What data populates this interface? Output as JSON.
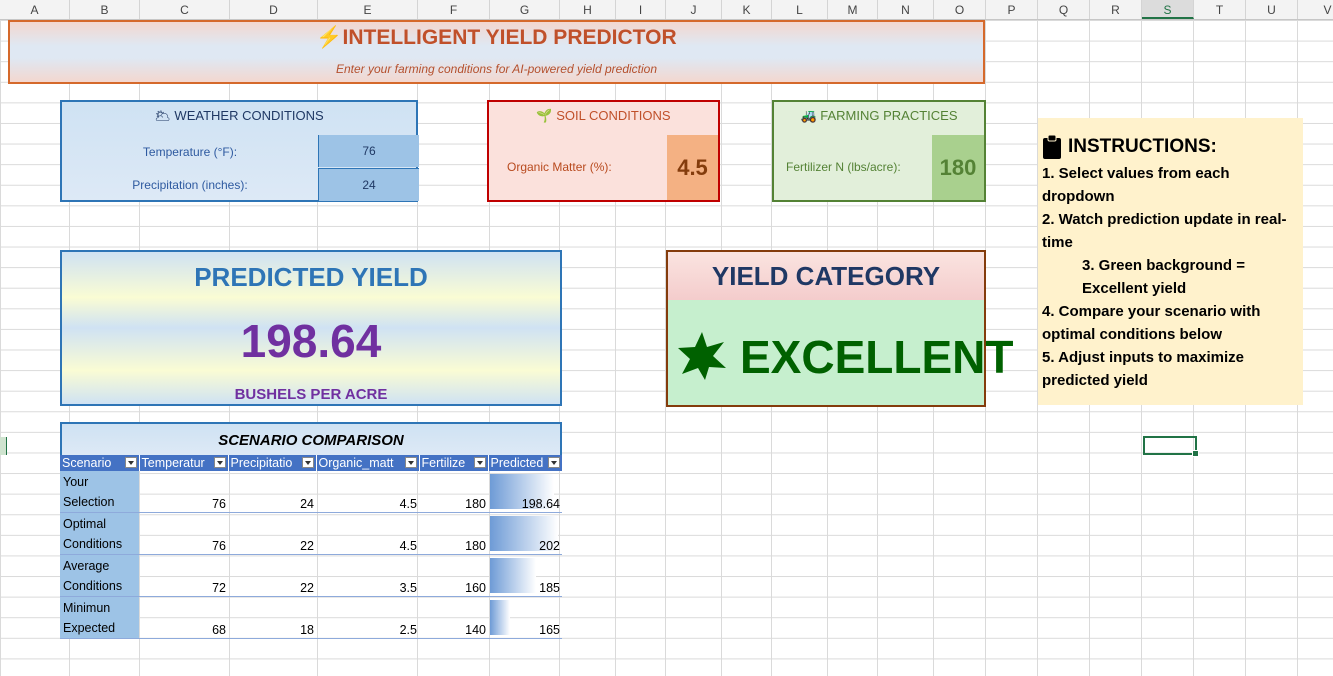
{
  "sheet": {
    "columns": [
      "A",
      "B",
      "C",
      "D",
      "E",
      "F",
      "G",
      "H",
      "I",
      "J",
      "K",
      "L",
      "M",
      "N",
      "O",
      "P",
      "Q",
      "R",
      "S",
      "T",
      "U",
      "V"
    ],
    "selected_column": "S"
  },
  "title": {
    "text": "⚡INTELLIGENT YIELD PREDICTOR",
    "subtitle": "Enter your farming conditions for AI-powered yield prediction"
  },
  "weather": {
    "header": "🌥 WEATHER CONDITIONS",
    "temperature_label": "Temperature (°F):",
    "temperature_value": "76",
    "precip_label": "Precipitation (inches):",
    "precip_value": "24"
  },
  "soil": {
    "header": "🌱 SOIL CONDITIONS",
    "organic_label": "Organic Matter (%):",
    "organic_value": "4.5"
  },
  "farming": {
    "header": "🚜 FARMING PRACTICES",
    "fert_label": "Fertilizer N (lbs/acre):",
    "fert_value": "180"
  },
  "predicted": {
    "header": "PREDICTED YIELD",
    "value": "198.64",
    "unit": "BUSHELS PER ACRE"
  },
  "category": {
    "header": "YIELD CATEGORY",
    "value": "EXCELLENT",
    "icon": "star-icon",
    "color": "#006100"
  },
  "instructions": {
    "header": "INSTRUCTIONS:",
    "icon": "clipboard-icon",
    "lines": [
      "1. Select values from each dropdown",
      "2. Watch prediction update in real-time",
      "3. Green background = Excellent yield",
      "4. Compare your scenario with optimal conditions below",
      "5. Adjust inputs to maximize predicted yield"
    ]
  },
  "scenario": {
    "title": "SCENARIO COMPARISON",
    "columns": [
      "Scenario",
      "Temperatur",
      "Precipitatio",
      "Organic_matt",
      "Fertilize",
      "Predicted"
    ],
    "rows": [
      {
        "name_1": "Your",
        "name_2": "Selection",
        "temp": "76",
        "precip": "24",
        "organic": "4.5",
        "fert": "180",
        "pred": "198.64",
        "pred_num": 198.64
      },
      {
        "name_1": "Optimal",
        "name_2": "Conditions",
        "temp": "76",
        "precip": "22",
        "organic": "4.5",
        "fert": "180",
        "pred": "202",
        "pred_num": 202
      },
      {
        "name_1": "Average",
        "name_2": "Conditions",
        "temp": "72",
        "precip": "22",
        "organic": "3.5",
        "fert": "160",
        "pred": "185",
        "pred_num": 185
      },
      {
        "name_1": "Minimun",
        "name_2": "Expected",
        "temp": "68",
        "precip": "18",
        "organic": "2.5",
        "fert": "140",
        "pred": "165",
        "pred_num": 165
      }
    ]
  }
}
